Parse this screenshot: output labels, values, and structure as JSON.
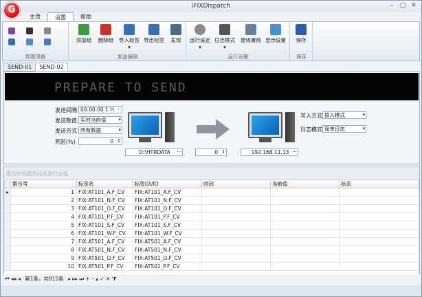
{
  "app": {
    "title": "iFIXDispatch",
    "logo_letter": "G"
  },
  "window_buttons": {
    "min": "–",
    "max": "□",
    "close": "✕"
  },
  "menu_tabs": [
    {
      "label": "主页"
    },
    {
      "label": "设置"
    },
    {
      "label": "帮助"
    }
  ],
  "ribbon": {
    "groups": [
      {
        "label": "界面风格"
      },
      {
        "label": "发送编辑"
      },
      {
        "label": "运行设置"
      },
      {
        "label": "保存"
      }
    ],
    "buttons": [
      {
        "label": "添加组",
        "icon": "add-group-icon",
        "color": "#3c9a3c"
      },
      {
        "label": "删除组",
        "icon": "delete-group-icon",
        "color": "#c8342c"
      },
      {
        "label": "导入标签 ▾",
        "icon": "import-tags-icon",
        "color": "#3b6fb3"
      },
      {
        "label": "导出标签",
        "icon": "export-tags-icon",
        "color": "#3b6fb3"
      },
      {
        "label": "发现",
        "icon": "discover-icon",
        "color": "#4b6a8c"
      },
      {
        "label": "运行设定 ▾",
        "icon": "gear-icon",
        "color": "#8a8a8a"
      },
      {
        "label": "日志模式 ▾",
        "icon": "log-icon",
        "color": "#555555"
      },
      {
        "label": "窗体置前",
        "icon": "window-front-icon",
        "color": "#6a7f99"
      },
      {
        "label": "显示设置",
        "icon": "display-settings-icon",
        "color": "#4a90d0"
      },
      {
        "label": "保存",
        "icon": "save-icon",
        "color": "#2a5ea8"
      }
    ]
  },
  "doc_tabs": [
    {
      "label": "SEND-01"
    },
    {
      "label": "SEND-02"
    }
  ],
  "banner": {
    "text": "PREPARE TO SEND"
  },
  "form": {
    "interval_label": "发送间隔",
    "interval_value": "00:00:00 1 H",
    "value_label": "发送数值",
    "value_value": "实时当前值",
    "mode_label": "发送方式",
    "mode_value": "所有数据",
    "deadband_label": "死区(%)",
    "deadband_value": "0",
    "write_label": "写入方式",
    "write_value": "插入模式",
    "log_label": "日志模式",
    "log_value": "简单日志"
  },
  "transfer": {
    "source_path": "D:\\HTRDATA",
    "count": "0",
    "target_ip": "192.168.11.13"
  },
  "grid": {
    "group_hint": "拖动列标题到此处进行分组",
    "columns": [
      "索引号",
      "标签名",
      "标签GUID",
      "时间",
      "当前值",
      "状态"
    ],
    "rows": [
      [
        "1",
        "FIX:AT101_A.F_CV",
        "FIX:AT101_A.F_CV"
      ],
      [
        "2",
        "FIX:AT101_N.F_CV",
        "FIX:AT101_N.F_CV"
      ],
      [
        "3",
        "FIX:AT101_O.F_CV",
        "FIX:AT101_O.F_CV"
      ],
      [
        "4",
        "FIX:AT101_P.F_CV",
        "FIX:AT101_P.F_CV"
      ],
      [
        "5",
        "FIX:AT101_S.F_CV",
        "FIX:AT101_S.F_CV"
      ],
      [
        "6",
        "FIX:AT101_W.F_CV",
        "FIX:AT101_W.F_CV"
      ],
      [
        "7",
        "FIX:AT501_A.F_CV",
        "FIX:AT501_A.F_CV"
      ],
      [
        "8",
        "FIX:AT501_N.F_CV",
        "FIX:AT501_N.F_CV"
      ],
      [
        "9",
        "FIX:AT501_O.F_CV",
        "FIX:AT501_O.F_CV"
      ],
      [
        "10",
        "FIX:AT501_P.F_CV",
        "FIX:AT501_P.F_CV"
      ]
    ]
  },
  "navigator": {
    "first": "⏮",
    "prev_page": "◂◂",
    "prev": "◂",
    "record_info": "第1条，共915条",
    "next": "▸",
    "next_page": "▸▸",
    "last": "⏭",
    "add": "+",
    "remove": "–",
    "edit": "▴",
    "apply": "✓",
    "cancel": "✕",
    "filter": "⧩"
  }
}
